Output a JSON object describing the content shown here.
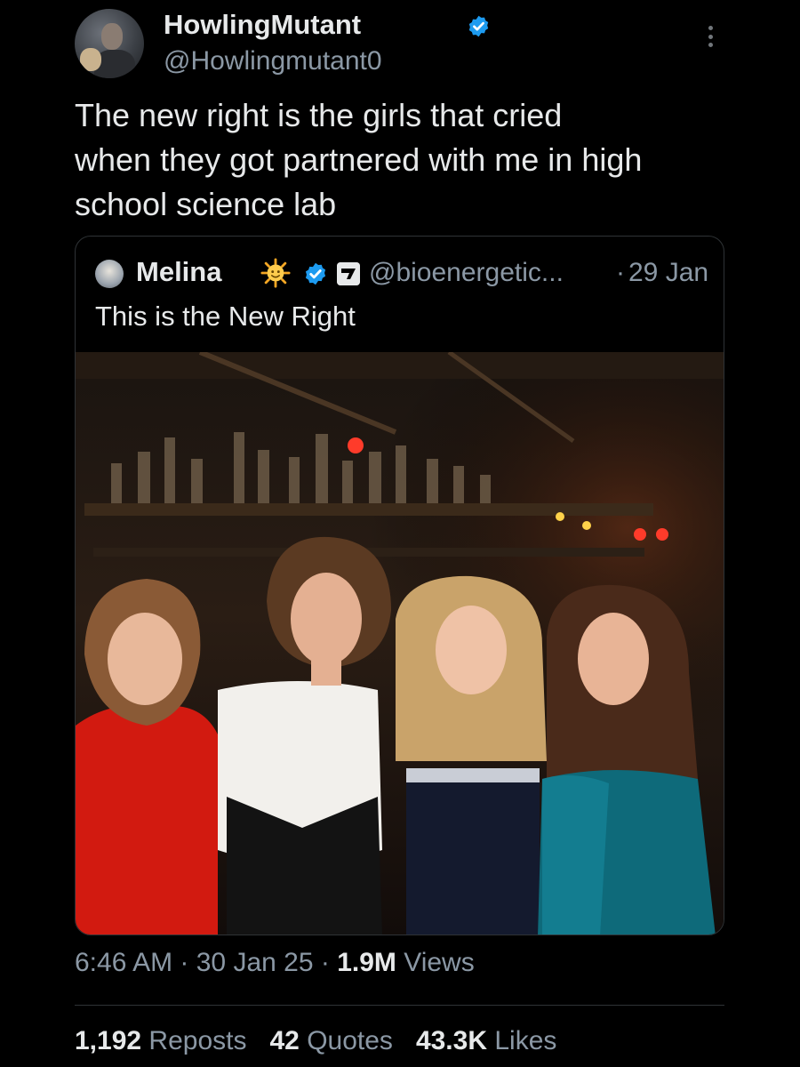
{
  "author": {
    "display_name": "HowlingMutant",
    "handle": "@Howlingmutant0"
  },
  "tweet": {
    "lines": [
      "The new right is the girls that cried",
      "when they got partnered with me in high",
      "school science lab"
    ]
  },
  "quoted": {
    "display_name": "Melina",
    "handle": "@bioenergetic...",
    "dot": "·",
    "date": "29 Jan",
    "text": "This is the New Right",
    "photo_icon": "photo-of-four-women-at-bar"
  },
  "meta": {
    "time": "6:46 AM",
    "sep1": " · ",
    "date": "30 Jan 25",
    "sep2": " · ",
    "views_value": "1.9M",
    "views_label": " Views"
  },
  "stats": {
    "reposts_value": "1,192",
    "reposts_label": "Reposts",
    "quotes_value": "42",
    "quotes_label": "Quotes",
    "likes_value": "43.3K",
    "likes_label": "Likes"
  },
  "colors": {
    "background": "#000000",
    "text": "#e7e9ea",
    "secondary_text": "#8b98a5",
    "verified_blue": "#1d9bf0",
    "border": "#2f3336"
  }
}
